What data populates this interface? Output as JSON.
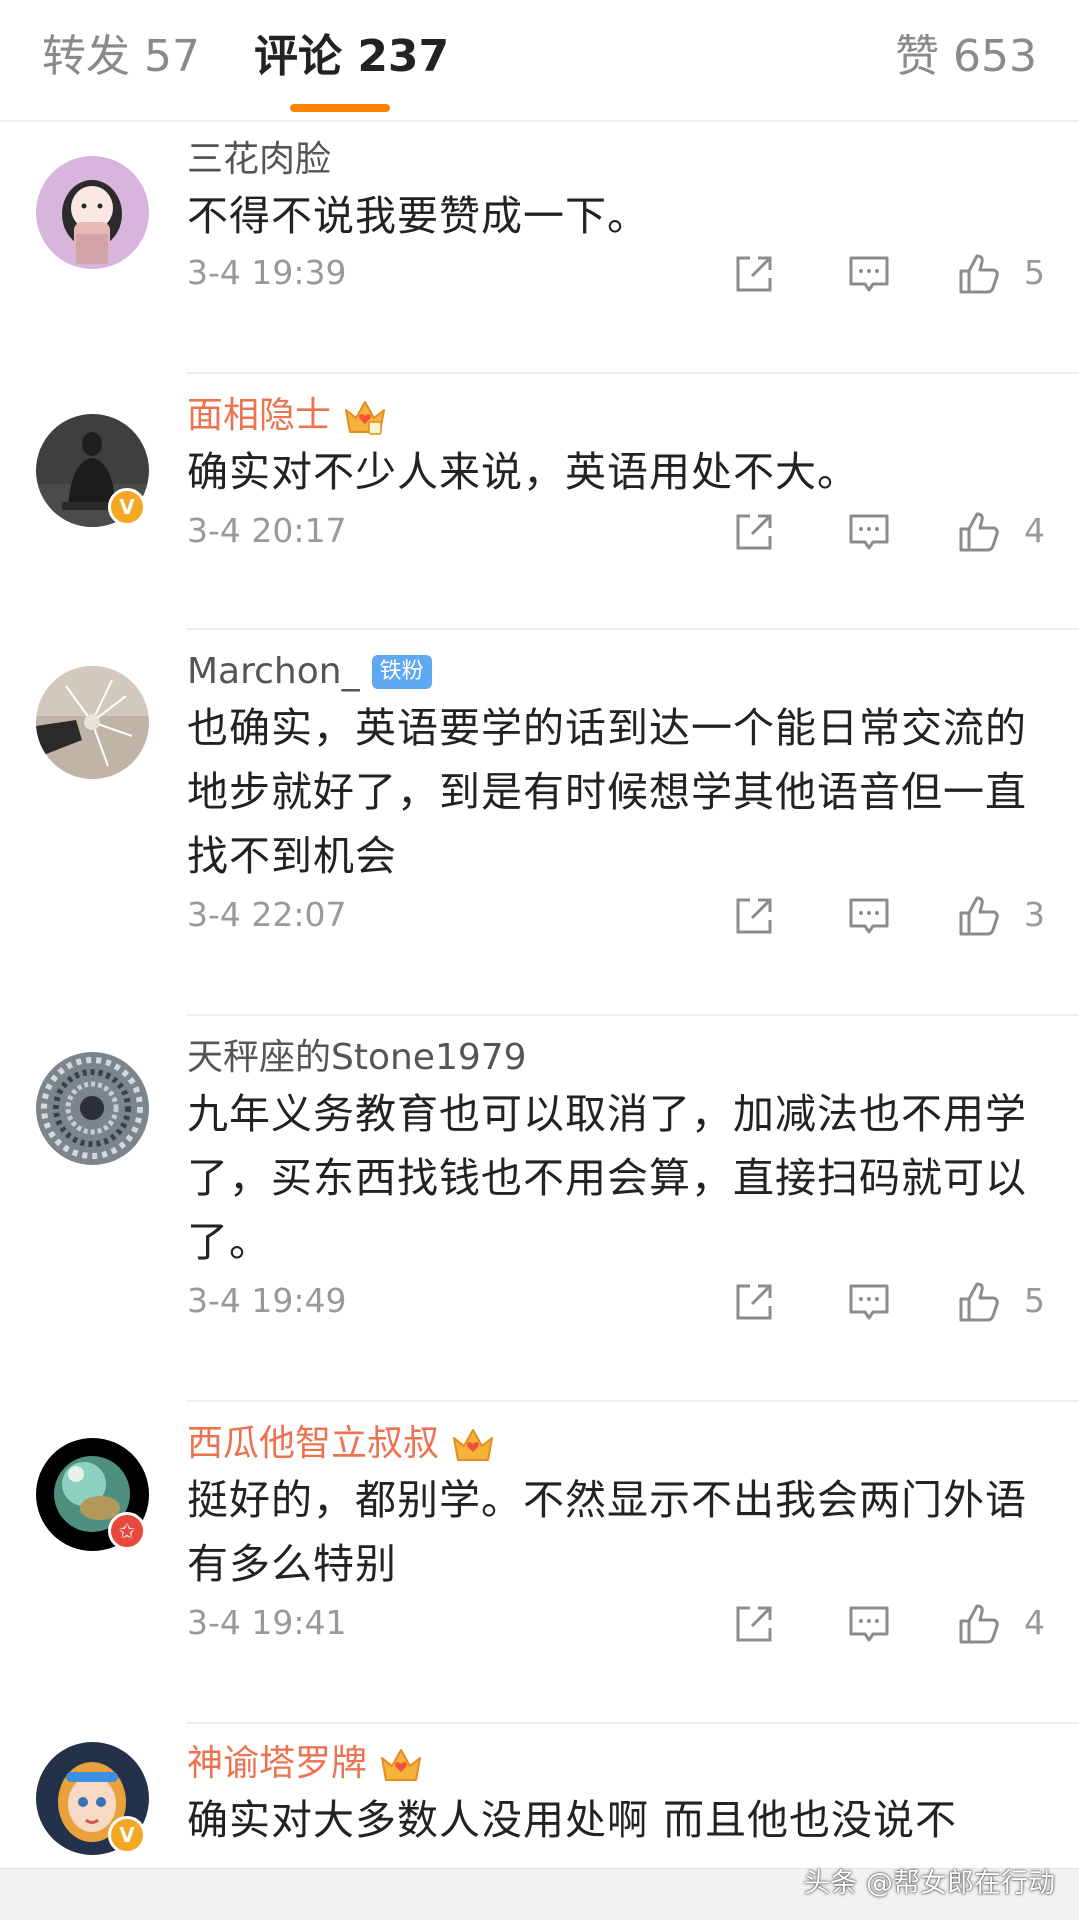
{
  "tabs": {
    "forward": "转发 57",
    "comments": "评论 237",
    "likes": "赞 653",
    "accent": "#ff8200"
  },
  "colors": {
    "name_default": "#555555",
    "name_member": "#eb7350",
    "meta": "#999999"
  },
  "comments": [
    {
      "username": "三花肉脸",
      "name_style": "default",
      "text": "不得不说我要赞成一下。",
      "time": "3-4 19:39",
      "likes": "5",
      "icons": [
        "share-icon",
        "reply-icon",
        "thumbs-up-icon"
      ]
    },
    {
      "username": "面相隐士",
      "name_style": "member",
      "badge": "crown-icon",
      "verified": "V",
      "text": "确实对不少人来说，英语用处不大。",
      "time": "3-4 20:17",
      "likes": "4"
    },
    {
      "username": "Marchon_",
      "name_style": "default",
      "fan_badge": "铁粉",
      "text": "也确实，英语要学的话到达一个能日常交流的地步就好了，到是有时候想学其他语音但一直找不到机会",
      "time": "3-4 22:07",
      "likes": "3"
    },
    {
      "username": "天秤座的Stone1979",
      "name_style": "default",
      "text": "九年义务教育也可以取消了，加减法也不用学了，买东西找钱也不用会算，直接扫码就可以了。",
      "time": "3-4 19:49",
      "likes": "5"
    },
    {
      "username": "西瓜他智立叔叔",
      "name_style": "member",
      "badge": "crown-icon",
      "verified": "✩",
      "text": "挺好的，都别学。不然显示不出我会两门外语有多么特别",
      "time": "3-4 19:41",
      "likes": "4"
    },
    {
      "username": "神谕塔罗牌",
      "name_style": "member",
      "badge": "crown-icon",
      "verified": "V",
      "text": "确实对大多数人没用处啊 而且他也没说不"
    }
  ],
  "watermark": "头条 @帮女郎在行动"
}
